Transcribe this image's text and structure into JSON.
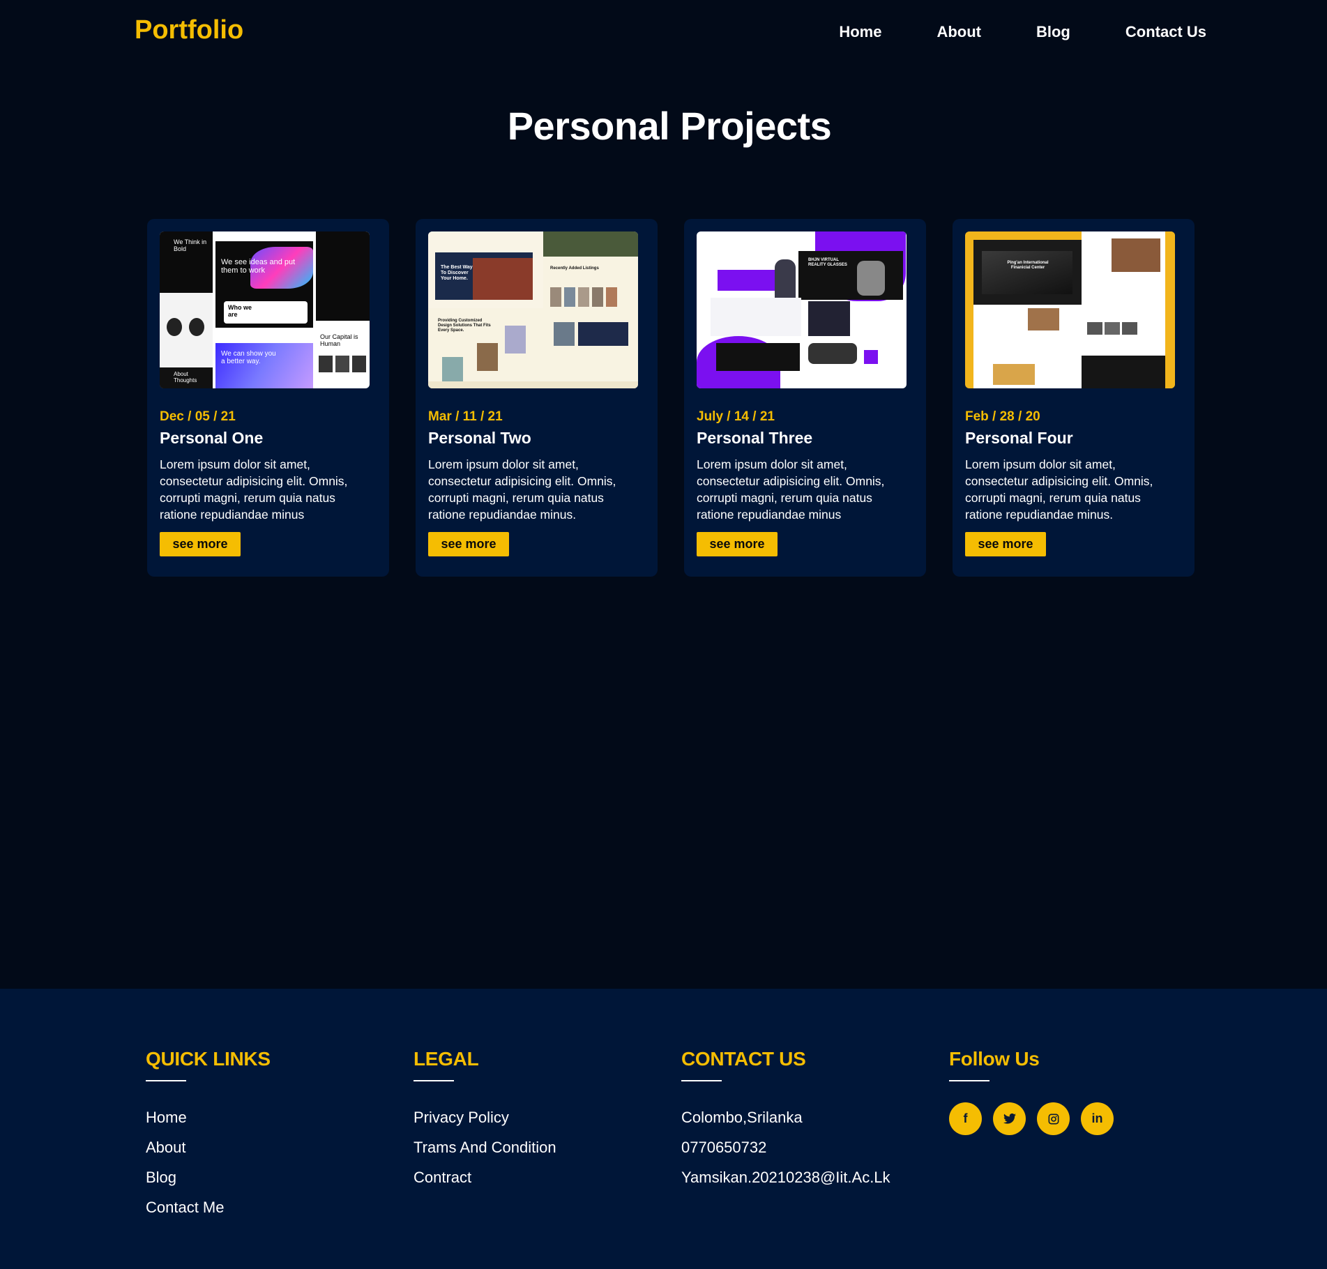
{
  "nav": {
    "brand": "Portfolio",
    "links": [
      "Home",
      "About",
      "Blog",
      "Contact Us"
    ]
  },
  "page": {
    "title": "Personal Projects"
  },
  "projects": [
    {
      "date": "Dec / 05 / 21",
      "title": "Personal One",
      "description": "Lorem ipsum dolor sit amet, consectetur adipisicing elit. Omnis, corrupti magni, rerum quia natus ratione repudiandae minus",
      "button": "see more",
      "thumb": {
        "t1": "We Think in Bold",
        "t2": "We see ideas and put them to work",
        "t3": "Who we are",
        "t4": "We can show you a better way.",
        "t5": "Our Capital is Human",
        "t6": "About Thoughts"
      }
    },
    {
      "date": "Mar / 11 / 21",
      "title": "Personal Two",
      "description": "Lorem ipsum dolor sit amet, consectetur adipisicing elit. Omnis, corrupti magni, rerum quia natus ratione repudiandae minus.",
      "button": "see more",
      "thumb": {
        "t1": "The Best Way To Discover Your Home.",
        "t2": "Recently Added Listings",
        "t3": "Providing Customized Design Solutions That Fits Every Space."
      }
    },
    {
      "date": "July / 14 / 21",
      "title": "Personal Three",
      "description": "Lorem ipsum dolor sit amet, consectetur adipisicing elit. Omnis, corrupti magni, rerum quia natus ratione repudiandae minus",
      "button": "see more",
      "thumb": {
        "t1": "BHJN VIRTUAL REALITY GLASSES"
      }
    },
    {
      "date": "Feb / 28 / 20",
      "title": "Personal Four",
      "description": "Lorem ipsum dolor sit amet, consectetur adipisicing elit. Omnis, corrupti magni, rerum quia natus ratione repudiandae minus.",
      "button": "see more",
      "thumb": {
        "t1": "Ping'an International Finanicial Center"
      }
    }
  ],
  "footer": {
    "quick_links": {
      "heading": "QUICK LINKS",
      "items": [
        "Home",
        "About",
        "Blog",
        "Contact Me"
      ]
    },
    "legal": {
      "heading": "LEGAL",
      "items": [
        "Privacy Policy",
        "Trams And Condition",
        "Contract"
      ]
    },
    "contact": {
      "heading": "CONTACT US",
      "items": [
        "Colombo,Srilanka",
        "0770650732",
        "Yamsikan.20210238@Iit.Ac.Lk"
      ]
    },
    "follow": {
      "heading": "Follow Us",
      "icons": [
        {
          "name": "facebook-icon",
          "glyph": "f"
        },
        {
          "name": "twitter-icon",
          "glyph": "🐦"
        },
        {
          "name": "instagram-icon",
          "glyph": "◎"
        },
        {
          "name": "linkedin-icon",
          "glyph": "in"
        }
      ]
    }
  },
  "colors": {
    "accent": "#f5bd02",
    "background": "#020a18",
    "card": "#001638"
  }
}
